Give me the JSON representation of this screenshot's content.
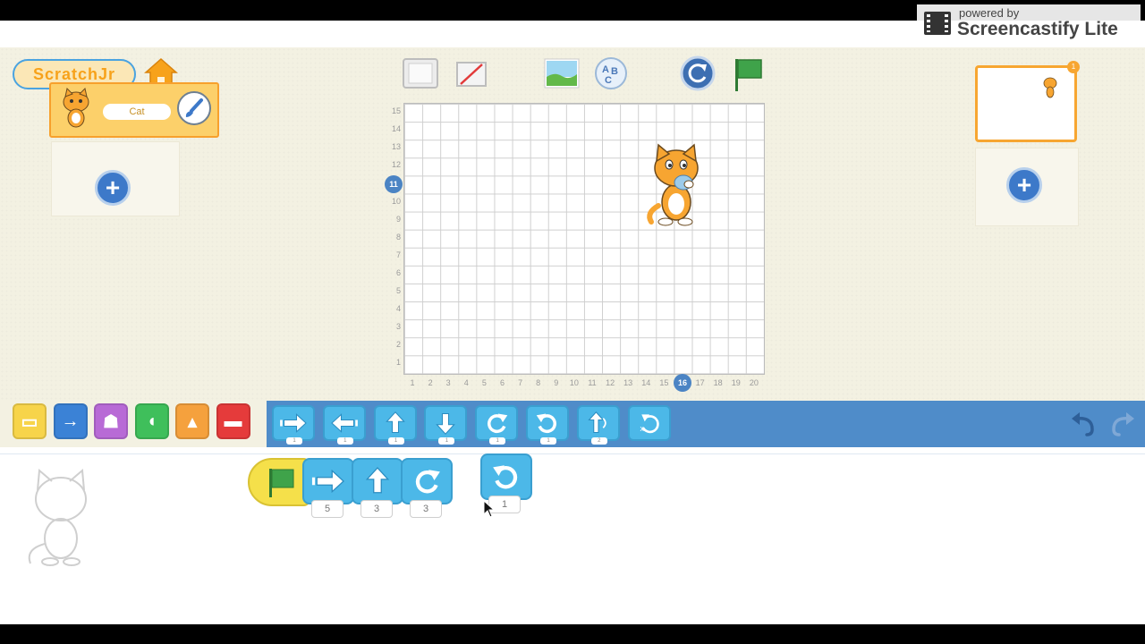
{
  "watermark": {
    "line1": "powered by",
    "line2": "Screencastify Lite"
  },
  "header": {
    "logo_text": "ScratchJr",
    "home_icon": "home-icon"
  },
  "toolbar": {
    "fullscreen_icon": "fullscreen-icon",
    "grid_icon": "grid-toggle-icon",
    "background_icon": "background-icon",
    "text_icon": "text-abc-icon",
    "reset_icon": "reset-icon",
    "flag_icon": "green-flag-icon"
  },
  "sprite": {
    "name": "Cat"
  },
  "stage": {
    "y_ticks": [
      "15",
      "14",
      "13",
      "12",
      "11",
      "10",
      "9",
      "8",
      "7",
      "6",
      "5",
      "4",
      "3",
      "2",
      "1"
    ],
    "x_ticks": [
      "1",
      "2",
      "3",
      "4",
      "5",
      "6",
      "7",
      "8",
      "9",
      "10",
      "11",
      "12",
      "13",
      "14",
      "15",
      "16",
      "17",
      "18",
      "19",
      "20"
    ],
    "highlight_x": "16",
    "highlight_y": "11"
  },
  "pages": {
    "current": "1"
  },
  "categories": [
    {
      "name": "triggering",
      "color": "#f7d44a"
    },
    {
      "name": "motion",
      "color": "#3b82d6"
    },
    {
      "name": "looks",
      "color": "#b86ad6"
    },
    {
      "name": "sound",
      "color": "#3fbf5b"
    },
    {
      "name": "control",
      "color": "#f5a13d"
    },
    {
      "name": "end",
      "color": "#e53b3b"
    }
  ],
  "palette_blocks": [
    {
      "name": "move-right",
      "num": "1"
    },
    {
      "name": "move-left",
      "num": "1"
    },
    {
      "name": "move-up",
      "num": "1"
    },
    {
      "name": "move-down",
      "num": "1"
    },
    {
      "name": "turn-right",
      "num": "1"
    },
    {
      "name": "turn-left",
      "num": "1"
    },
    {
      "name": "hop",
      "num": "2"
    },
    {
      "name": "go-home",
      "num": ""
    }
  ],
  "script": {
    "blocks": [
      {
        "name": "green-flag-trigger",
        "num": ""
      },
      {
        "name": "move-right",
        "num": "5"
      },
      {
        "name": "move-up",
        "num": "3"
      },
      {
        "name": "turn-right",
        "num": "3"
      }
    ],
    "loose_block": {
      "name": "turn-left",
      "num": "1"
    }
  },
  "undo_icon": "undo-icon",
  "redo_icon": "redo-icon"
}
